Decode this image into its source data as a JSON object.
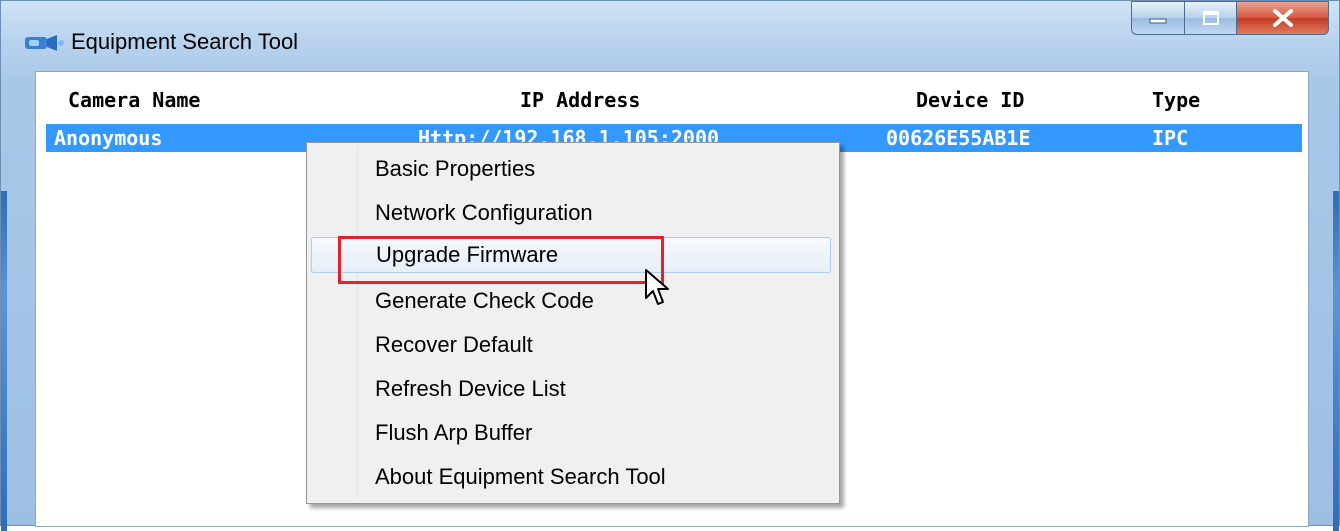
{
  "window": {
    "title": "Equipment Search Tool",
    "controls": [
      "minimize-icon",
      "maximize-icon",
      "close-icon"
    ]
  },
  "table": {
    "columns": [
      "Camera Name",
      "IP Address",
      "Device ID",
      "Type"
    ],
    "rows": [
      {
        "camera_name": "Anonymous",
        "ip_address": "Http://192.168.1.105:2000",
        "device_id": "00626E55AB1E",
        "type": "IPC",
        "selected": true
      }
    ]
  },
  "context_menu": {
    "items": [
      "Basic Properties",
      "Network Configuration",
      "Upgrade Firmware",
      "Generate Check Code",
      "Recover Default",
      "Refresh Device List",
      "Flush Arp Buffer",
      "About Equipment Search Tool"
    ],
    "hovered_item": "Upgrade Firmware"
  },
  "colors": {
    "selection": "#3399ff",
    "highlight_box": "#e8202a",
    "close_button": "#c23b22"
  }
}
